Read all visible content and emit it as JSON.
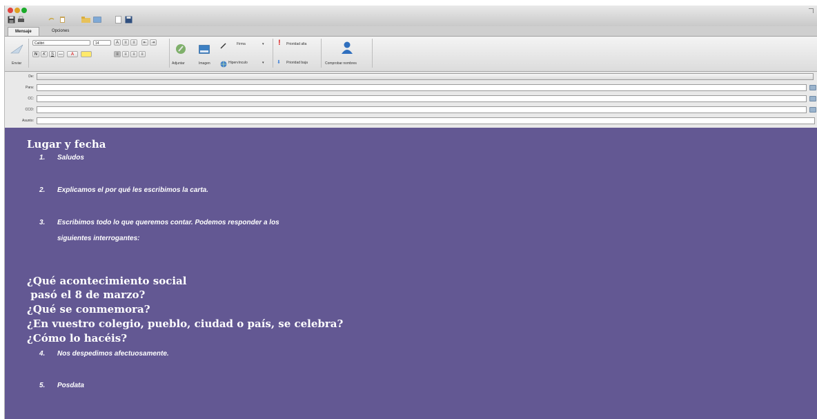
{
  "colors": {
    "body_background": "#635893",
    "body_text": "#ffffff",
    "chrome_background": "#e7e7e7"
  },
  "tabs": [
    {
      "label": "Mensaje",
      "active": true
    },
    {
      "label": "Opciones",
      "active": false
    }
  ],
  "ribbon": {
    "send_label": "Enviar",
    "font_name": "Calibri",
    "font_size": "14",
    "bold_glyph": "N",
    "italic_glyph": "K",
    "underline_glyph": "S",
    "attach_label": "Adjuntar",
    "image_label": "Imagen",
    "signature_label": "Firma",
    "hyperlink_label": "Hipervínculo",
    "high_priority_label": "Prioridad alta",
    "low_priority_label": "Prioridad baja",
    "check_names_label": "Comprobar nombres"
  },
  "header_fields": {
    "from_label": "De:",
    "to_label": "Para:",
    "cc_label": "CC:",
    "bcc_label": "CCO:",
    "subject_label": "Asunto:"
  },
  "body": {
    "heading": "Lugar y fecha",
    "items_top": [
      {
        "num": "1.",
        "text": "Saludos"
      },
      {
        "num": "2.",
        "text": "Explicamos el por qué les escribimos la carta."
      },
      {
        "num": "3.",
        "text": "Escribimos todo lo que queremos contar. Podemos responder a los"
      }
    ],
    "item3_continuation": "siguientes interrogantes:",
    "questions": [
      "¿Qué acontecimiento social",
      " pasó el 8 de marzo?",
      "¿Qué se conmemora?",
      "¿En vuestro colegio, pueblo, ciudad o país, se celebra?",
      "¿Cómo lo hacéis?"
    ],
    "items_bottom": [
      {
        "num": "4.",
        "text": "Nos despedimos afectuosamente."
      },
      {
        "num": "5.",
        "text": "Posdata"
      }
    ]
  }
}
